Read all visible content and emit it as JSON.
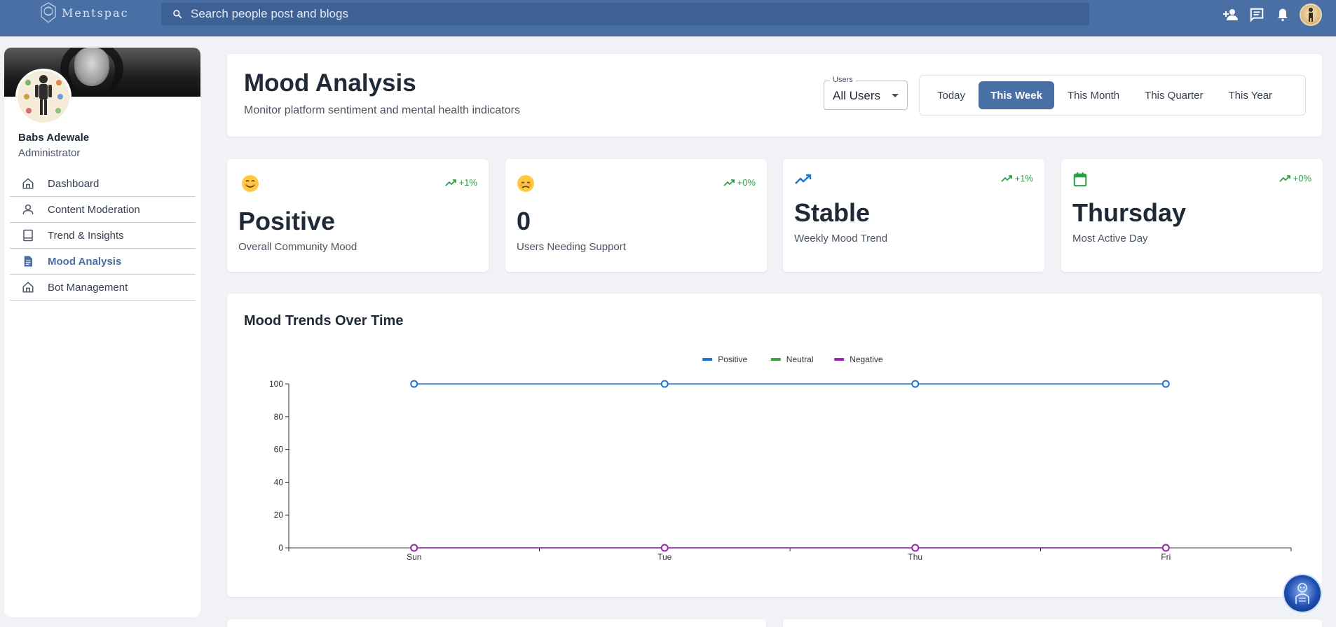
{
  "app": {
    "logo_text": "Mentspac",
    "search_placeholder": "Search people post and blogs"
  },
  "profile": {
    "name": "Babs Adewale",
    "role": "Administrator"
  },
  "sidebar": {
    "items": [
      {
        "label": "Dashboard",
        "icon": "home-icon",
        "active": false
      },
      {
        "label": "Content Moderation",
        "icon": "person-icon",
        "active": false
      },
      {
        "label": "Trend & Insights",
        "icon": "book-icon",
        "active": false
      },
      {
        "label": "Mood Analysis",
        "icon": "document-icon",
        "active": true
      },
      {
        "label": "Bot Management",
        "icon": "home-icon",
        "active": false
      }
    ]
  },
  "header": {
    "title": "Mood Analysis",
    "subtitle": "Monitor platform sentiment and mental health indicators",
    "users_label": "Users",
    "users_value": "All Users",
    "periods": [
      "Today",
      "This Week",
      "This Month",
      "This Quarter",
      "This Year"
    ],
    "active_period": "This Week"
  },
  "stats": [
    {
      "icon": "smile-emoji-icon",
      "trend": "+1%",
      "value": "Positive",
      "label": "Overall Community Mood"
    },
    {
      "icon": "sad-emoji-icon",
      "trend": "+0%",
      "value": "0",
      "label": "Users Needing Support"
    },
    {
      "icon": "trending-up-icon",
      "trend": "+1%",
      "value": "Stable",
      "label": "Weekly Mood Trend"
    },
    {
      "icon": "calendar-icon",
      "trend": "+0%",
      "value": "Thursday",
      "label": "Most Active Day"
    }
  ],
  "colors": {
    "brand": "#4a6fa5",
    "trend_green": "#2e9e44",
    "positive": "#1976d2",
    "neutral": "#43a047",
    "negative": "#9c27b0"
  },
  "chart_data": {
    "type": "line",
    "title": "Mood Trends Over Time",
    "x": [
      "Sun",
      "Tue",
      "Thu",
      "Fri"
    ],
    "series": [
      {
        "name": "Positive",
        "color": "#1976d2",
        "values": [
          100,
          100,
          100,
          100
        ]
      },
      {
        "name": "Neutral",
        "color": "#43a047",
        "values": [
          0,
          0,
          0,
          0
        ]
      },
      {
        "name": "Negative",
        "color": "#9c27b0",
        "values": [
          0,
          0,
          0,
          0
        ]
      }
    ],
    "yticks": [
      0,
      20,
      40,
      60,
      80,
      100
    ],
    "ylim": [
      0,
      100
    ],
    "legend": "top-center",
    "grid": false
  }
}
